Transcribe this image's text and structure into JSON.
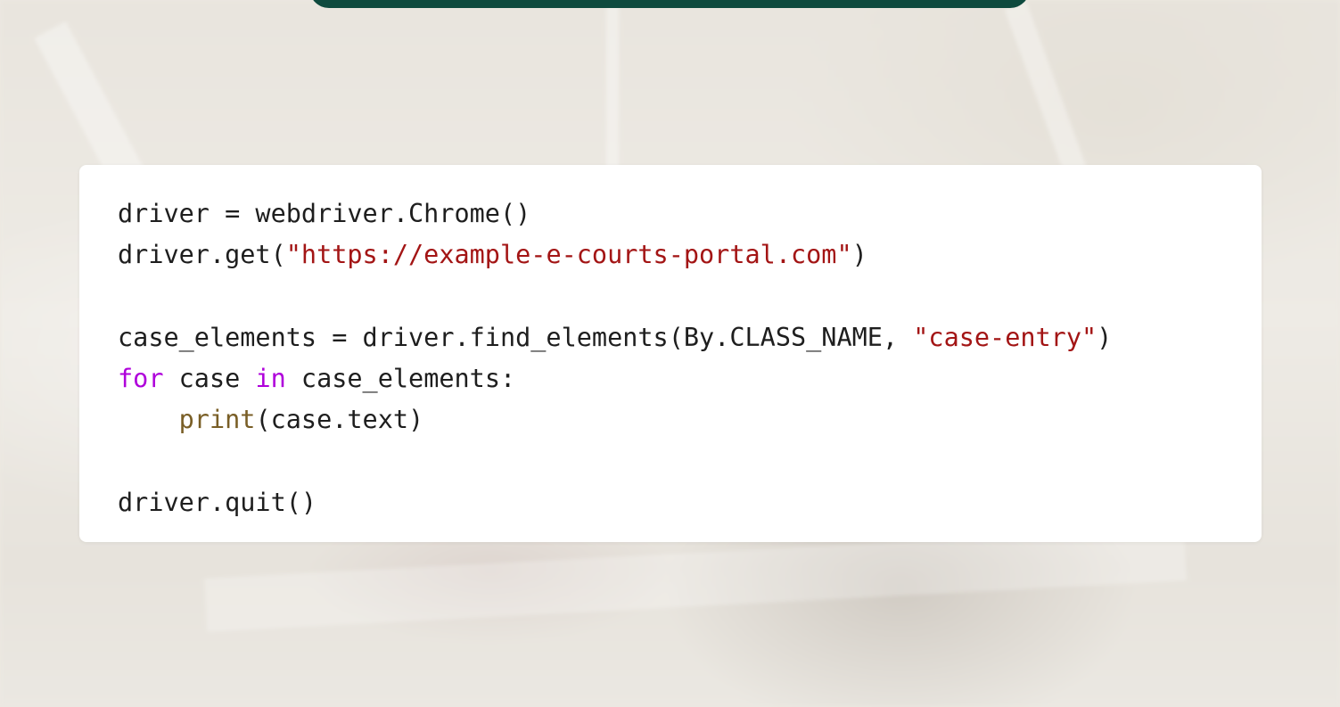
{
  "colors": {
    "banner": "#0e4a3e",
    "code_text": "#1e1e1e",
    "string": "#a31515",
    "keyword": "#af00db",
    "builtin_function": "#795e26",
    "card_background": "#ffffff"
  },
  "code_block": {
    "lines": [
      {
        "tokens": [
          {
            "text": "driver = webdriver.Chrome()",
            "kind": "plain"
          }
        ]
      },
      {
        "tokens": [
          {
            "text": "driver.get(",
            "kind": "plain"
          },
          {
            "text": "\"https://example-e-courts-portal.com\"",
            "kind": "string"
          },
          {
            "text": ")",
            "kind": "plain"
          }
        ]
      },
      {
        "tokens": []
      },
      {
        "tokens": [
          {
            "text": "case_elements = driver.find_elements(By.CLASS_NAME, ",
            "kind": "plain"
          },
          {
            "text": "\"case-entry\"",
            "kind": "string"
          },
          {
            "text": ")",
            "kind": "plain"
          }
        ]
      },
      {
        "tokens": [
          {
            "text": "for",
            "kind": "keyword"
          },
          {
            "text": " case ",
            "kind": "plain"
          },
          {
            "text": "in",
            "kind": "keyword"
          },
          {
            "text": " case_elements:",
            "kind": "plain"
          }
        ]
      },
      {
        "tokens": [
          {
            "text": "    ",
            "kind": "plain"
          },
          {
            "text": "print",
            "kind": "function"
          },
          {
            "text": "(case.text)",
            "kind": "plain"
          }
        ]
      },
      {
        "tokens": []
      },
      {
        "tokens": [
          {
            "text": "driver.quit()",
            "kind": "plain"
          }
        ]
      }
    ]
  }
}
